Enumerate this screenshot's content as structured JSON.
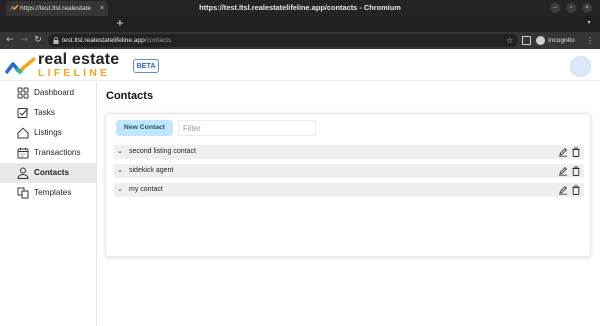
{
  "window": {
    "title": "https://test.ltsl.realestatelifeline.app/contacts - Chromium"
  },
  "tab": {
    "title": "https://test.ltsl.realestate",
    "close": "×"
  },
  "new_tab": "+",
  "toolbar": {
    "url_host": "test.ltsl.realestatelifeline.app",
    "url_path": "/contacts",
    "incognito_label": "Incognito"
  },
  "brand": {
    "line1": "real estate",
    "line2": "LIFELINE",
    "badge": "BETA",
    "accent_color": "#f5a623",
    "mark_colors": [
      "#2a6ac8",
      "#2bb5a0",
      "#f5a623"
    ]
  },
  "sidebar": {
    "items": [
      {
        "label": "Dashboard",
        "icon": "dashboard-icon"
      },
      {
        "label": "Tasks",
        "icon": "tasks-icon"
      },
      {
        "label": "Listings",
        "icon": "home-icon"
      },
      {
        "label": "Transactions",
        "icon": "calendar-icon"
      },
      {
        "label": "Contacts",
        "icon": "user-icon",
        "active": true
      },
      {
        "label": "Templates",
        "icon": "templates-icon"
      }
    ]
  },
  "main": {
    "title": "Contacts",
    "new_button": "New Contact",
    "filter_placeholder": "Filter",
    "contacts": [
      {
        "name": "second listing contact"
      },
      {
        "name": "sidekick agent"
      },
      {
        "name": "my contact"
      }
    ]
  },
  "colors": {
    "new_button_bg": "#bfe6fa",
    "active_nav_bg": "#e9e9e9",
    "badge_blue": "#2a6ac8"
  }
}
